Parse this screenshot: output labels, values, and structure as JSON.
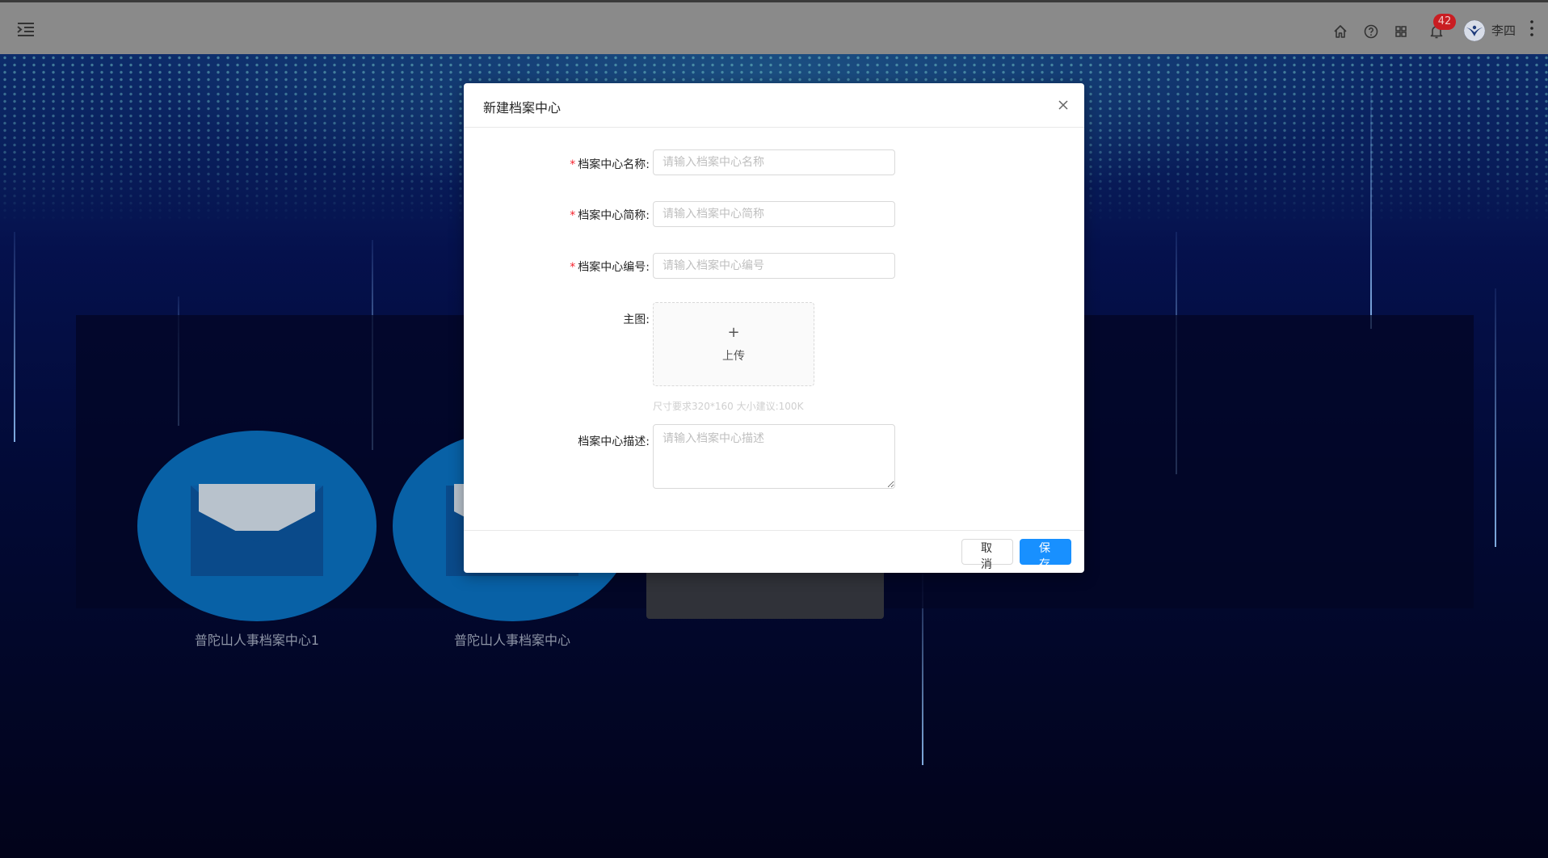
{
  "header": {
    "notification_count": "42",
    "username": "李四"
  },
  "background": {
    "cards": [
      {
        "label": "普陀山人事档案中心1"
      },
      {
        "label": "普陀山人事档案中心"
      }
    ]
  },
  "dialog": {
    "title": "新建档案中心",
    "fields": {
      "name": {
        "label": "档案中心名称:",
        "placeholder": "请输入档案中心名称",
        "required_mark": "*"
      },
      "short_name": {
        "label": "档案中心简称:",
        "placeholder": "请输入档案中心简称",
        "required_mark": "*"
      },
      "code": {
        "label": "档案中心编号:",
        "placeholder": "请输入档案中心编号",
        "required_mark": "*"
      },
      "main_image": {
        "label": "主图:",
        "upload_plus": "+",
        "upload_text": "上传",
        "hint": "尺寸要求320*160 大小建议:100K"
      },
      "description": {
        "label": "档案中心描述:",
        "placeholder": "请输入档案中心描述"
      }
    },
    "buttons": {
      "cancel": "取 消",
      "save": "保 存"
    }
  },
  "colors": {
    "primary": "#1890ff",
    "required": "#f5222d",
    "badge": "#c91d22",
    "header_bg": "#8a8a8a"
  },
  "icons": [
    "menu-fold-icon",
    "home-icon",
    "help-icon",
    "apps-icon",
    "bell-icon",
    "avatar",
    "more-icon",
    "close-icon",
    "plus-icon"
  ]
}
